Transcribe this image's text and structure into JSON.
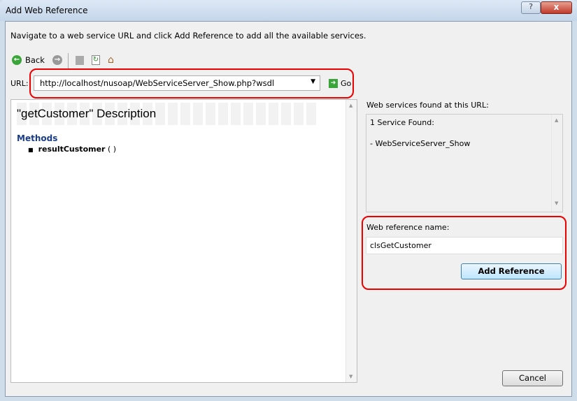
{
  "window": {
    "title": "Add Web Reference",
    "help": "?",
    "close": "x"
  },
  "instruction": "Navigate to a web service URL and click Add Reference to add all the available services.",
  "toolbar": {
    "back_label": "Back",
    "icons": [
      "back-icon",
      "forward-icon",
      "stop-icon",
      "refresh-icon",
      "home-icon"
    ]
  },
  "url": {
    "label": "URL:",
    "value": "http://localhost/nusoap/WebServiceServer_Show.php?wsdl",
    "go_label": "Go"
  },
  "browser": {
    "title": "\"getCustomer\" Description",
    "methods_heading": "Methods",
    "methods": [
      {
        "name": "resultCustomer",
        "args": " ( )"
      }
    ]
  },
  "services": {
    "label": "Web services found at this URL:",
    "count_text": "1 Service Found:",
    "items": [
      "- WebServiceServer_Show"
    ]
  },
  "reference": {
    "label": "Web reference name:",
    "value": "clsGetCustomer",
    "add_button": "Add Reference"
  },
  "cancel_button": "Cancel",
  "colors": {
    "highlight": "#e00000",
    "methods_heading": "#1a3c8c"
  }
}
